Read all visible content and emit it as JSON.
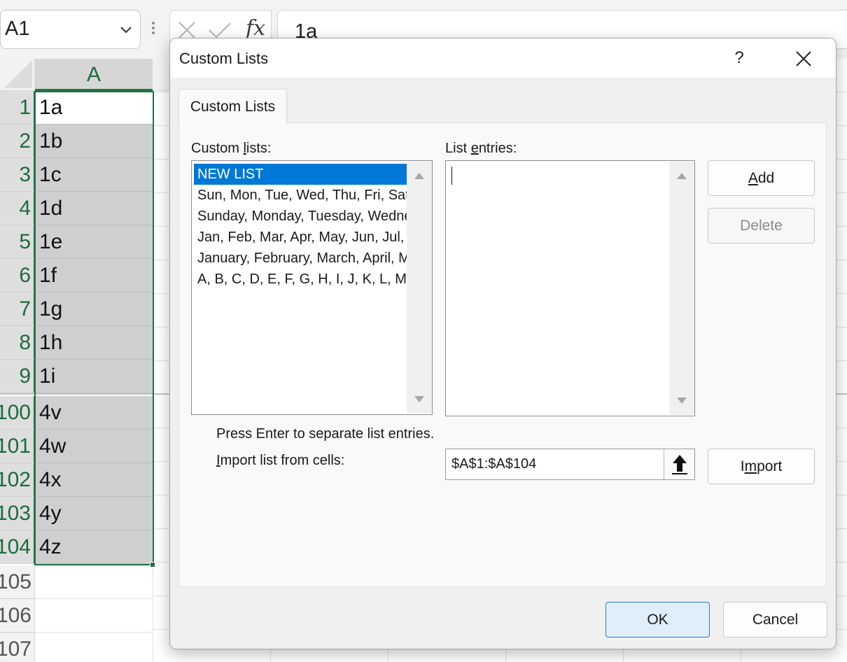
{
  "formula_bar": {
    "name_box": "A1",
    "formula": "1a"
  },
  "sheet": {
    "column_header": "A",
    "rows": [
      {
        "num": "1",
        "value": "1a"
      },
      {
        "num": "2",
        "value": "1b"
      },
      {
        "num": "3",
        "value": "1c"
      },
      {
        "num": "4",
        "value": "1d"
      },
      {
        "num": "5",
        "value": "1e"
      },
      {
        "num": "6",
        "value": "1f"
      },
      {
        "num": "7",
        "value": "1g"
      },
      {
        "num": "8",
        "value": "1h"
      },
      {
        "num": "9",
        "value": "1i"
      },
      {
        "num": "100",
        "value": "4v"
      },
      {
        "num": "101",
        "value": "4w"
      },
      {
        "num": "102",
        "value": "4x"
      },
      {
        "num": "103",
        "value": "4y"
      },
      {
        "num": "104",
        "value": "4z"
      },
      {
        "num": "105",
        "value": ""
      },
      {
        "num": "106",
        "value": ""
      },
      {
        "num": "107",
        "value": ""
      }
    ]
  },
  "dialog": {
    "title": "Custom Lists",
    "help": "?",
    "tab": "Custom Lists",
    "custom_lists_label": {
      "pre": "Custom ",
      "key": "l",
      "post": "ists:"
    },
    "list_entries_label": {
      "pre": "List ",
      "key": "e",
      "post": "ntries:"
    },
    "custom_lists": [
      "NEW LIST",
      "Sun, Mon, Tue, Wed, Thu, Fri, Sat",
      "Sunday, Monday, Tuesday, Wednesday",
      "Jan, Feb, Mar, Apr, May, Jun, Jul,",
      "January, February, March, April, May",
      "A, B, C, D, E, F, G, H, I, J, K, L, M,"
    ],
    "selected_list_index": 0,
    "add_label": {
      "pre": "",
      "key": "A",
      "post": "dd"
    },
    "delete_label": "Delete",
    "hint": "Press Enter to separate list entries.",
    "import_label": {
      "pre": "",
      "key": "I",
      "post": "mport list from cells:"
    },
    "import_range": "$A$1:$A$104",
    "import_button": {
      "pre": "I",
      "key": "m",
      "post": "port"
    },
    "ok_label": "OK",
    "cancel_label": "Cancel"
  }
}
